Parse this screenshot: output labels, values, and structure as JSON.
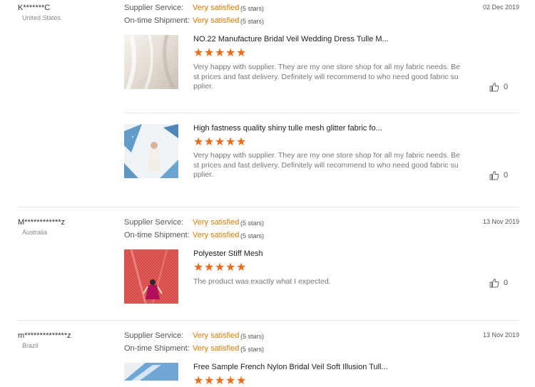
{
  "labels": {
    "supplier_service": "Supplier Service:",
    "on_time_shipment": "On-time Shipment:"
  },
  "reviews": [
    {
      "reviewer": "K*******C",
      "country": "United States",
      "date": "02 Dec 2019",
      "supplier_service": {
        "text": "Very satisfied",
        "stars": "(5 stars)"
      },
      "on_time_shipment": {
        "text": "Very satisfied",
        "stars": "(5 stars)"
      },
      "products": [
        {
          "title": "NO.22 Manufacture Bridal Veil Wedding Dress Tulle M...",
          "rating": 5,
          "comment": "Very happy with supplier. They are my one store shop for all my fabric needs. Best prices and fast delivery. Definitely will recommend to who need good fabric supplier.",
          "likes": "0"
        },
        {
          "title": "High fastness quality shiny tulle mesh glitter fabric fo...",
          "rating": 5,
          "comment": "Very happy with supplier. They are my one store shop for all my fabric needs. Best prices and fast delivery. Definitely will recommend to who need good fabric supplier.",
          "likes": "0"
        }
      ]
    },
    {
      "reviewer": "M************z",
      "country": "Australia",
      "date": "13 Nov 2019",
      "supplier_service": {
        "text": "Very satisfied",
        "stars": "(5 stars)"
      },
      "on_time_shipment": {
        "text": "Very satisfied",
        "stars": "(5 stars)"
      },
      "products": [
        {
          "title": "Polyester Stiff Mesh",
          "rating": 5,
          "comment": "The product was exactly what I expected.",
          "likes": "0"
        }
      ]
    },
    {
      "reviewer": "m**************z",
      "country": "Brazil",
      "date": "13 Nov 2019",
      "supplier_service": {
        "text": "Very satisfied",
        "stars": "(5 stars)"
      },
      "on_time_shipment": {
        "text": "Very satisfied",
        "stars": "(5 stars)"
      },
      "products": [
        {
          "title": "Free Sample French Nylon Bridal Veil Soft Illusion Tull...",
          "rating": 5,
          "comment": "",
          "likes": ""
        }
      ]
    }
  ],
  "colors": {
    "accent_orange": "#e07a00",
    "star_orange": "#f26b13",
    "separator": "#e6e6e6"
  },
  "icons": {
    "star": "star-icon",
    "like": "thumbs-up-icon"
  }
}
